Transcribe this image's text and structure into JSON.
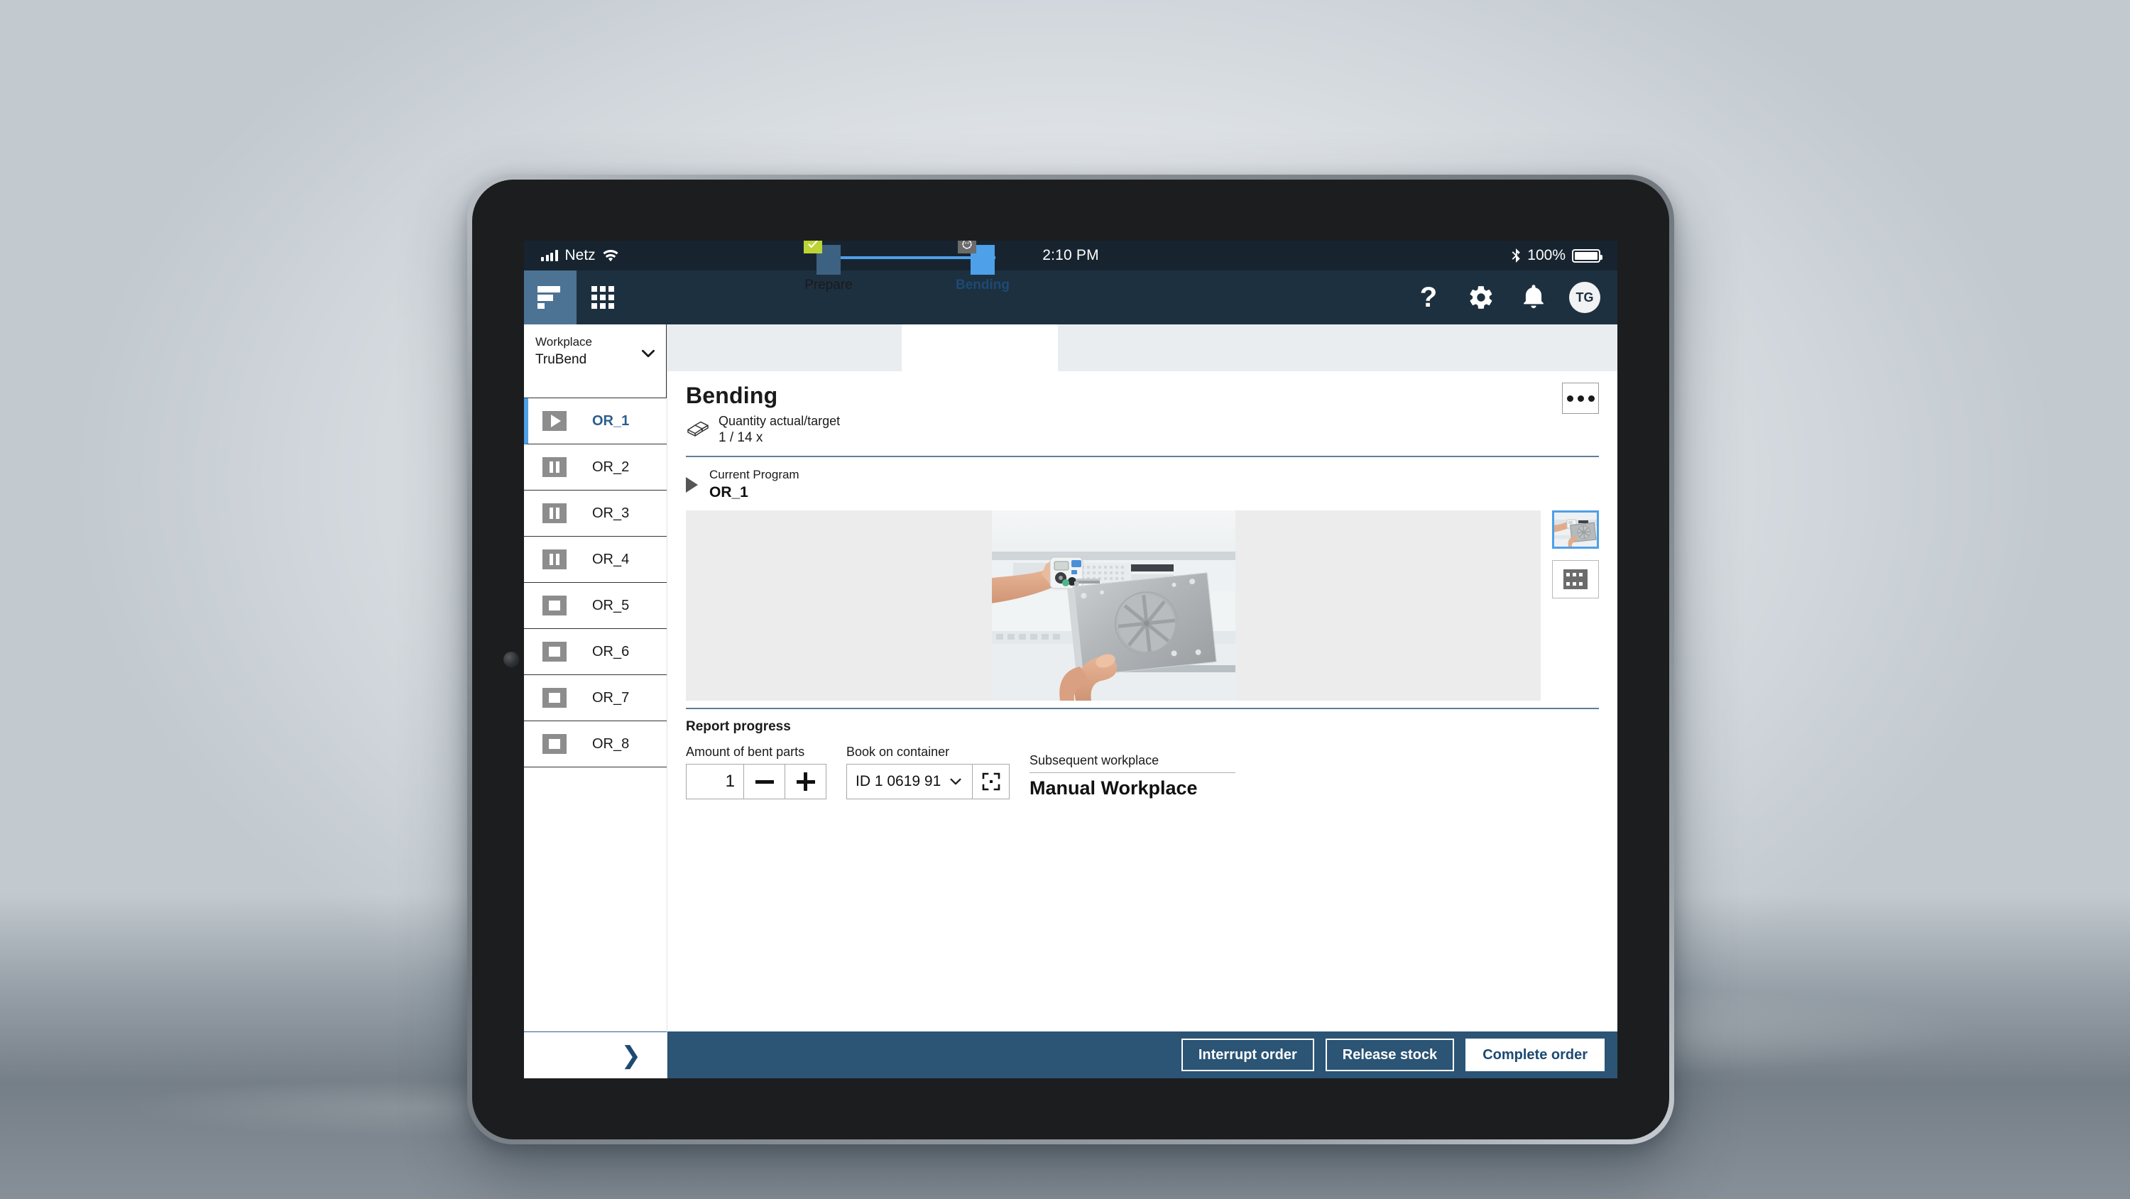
{
  "status_bar": {
    "carrier": "Netz",
    "time": "2:10 PM",
    "battery_percent": "100%",
    "icons": [
      "signal-icon",
      "wifi-icon",
      "bluetooth-icon",
      "battery-icon"
    ]
  },
  "app_header": {
    "logo": "trumpf-logo-icon",
    "apps_label": "apps-grid-icon",
    "help": "?",
    "icons": [
      "help-icon",
      "gear-icon",
      "bell-icon"
    ],
    "avatar_initials": "TG",
    "bg_color": "#1d3040",
    "brand_tile_color": "#4c7394"
  },
  "sidebar": {
    "workplace_label": "Workplace",
    "workplace_value": "TruBend",
    "orders": [
      {
        "label": "OR_1",
        "state": "play",
        "active": true
      },
      {
        "label": "OR_2",
        "state": "pause",
        "active": false
      },
      {
        "label": "OR_3",
        "state": "pause",
        "active": false
      },
      {
        "label": "OR_4",
        "state": "pause",
        "active": false
      },
      {
        "label": "OR_5",
        "state": "stop",
        "active": false
      },
      {
        "label": "OR_6",
        "state": "stop",
        "active": false
      },
      {
        "label": "OR_7",
        "state": "stop",
        "active": false
      },
      {
        "label": "OR_8",
        "state": "stop",
        "active": false
      }
    ],
    "expand_chevron": "chevron-right-icon"
  },
  "process_steps": [
    {
      "label": "Prepare",
      "state": "completed",
      "badge": "check-icon",
      "active": false
    },
    {
      "label": "Bending",
      "state": "in-progress",
      "badge": "progress-icon",
      "active": true
    }
  ],
  "main": {
    "title": "Bending",
    "quantity_label": "Quantity actual/target",
    "quantity_value": "1 / 14 x",
    "quantity_icon": "bent-sheet-icon",
    "more_button": "more-options-icon",
    "current_program_label": "Current Program",
    "current_program_value": "OR_1",
    "current_program_icon": "play-icon",
    "thumbnails": [
      {
        "name": "photo-thumbnail",
        "selected": true
      },
      {
        "name": "video-thumbnail",
        "selected": false
      }
    ]
  },
  "report_progress": {
    "section_title": "Report progress",
    "amount_label": "Amount of bent parts",
    "amount_value": "1",
    "decrement_icon": "minus-icon",
    "increment_icon": "plus-icon",
    "container_label": "Book on container",
    "container_value": "ID 1 0619 91",
    "container_chevron": "chevron-down-icon",
    "scan_icon": "scan-barcode-icon",
    "subsequent_label": "Subsequent workplace",
    "subsequent_value": "Manual Workplace"
  },
  "footer": {
    "interrupt_label": "Interrupt order",
    "release_label": "Release stock",
    "complete_label": "Complete order",
    "bg_color": "#2b5475"
  },
  "colors": {
    "accent_blue": "#4ea0e8",
    "dark_blue": "#1d3040",
    "step_done": "#3d6181",
    "badge_green": "#bcd435"
  }
}
